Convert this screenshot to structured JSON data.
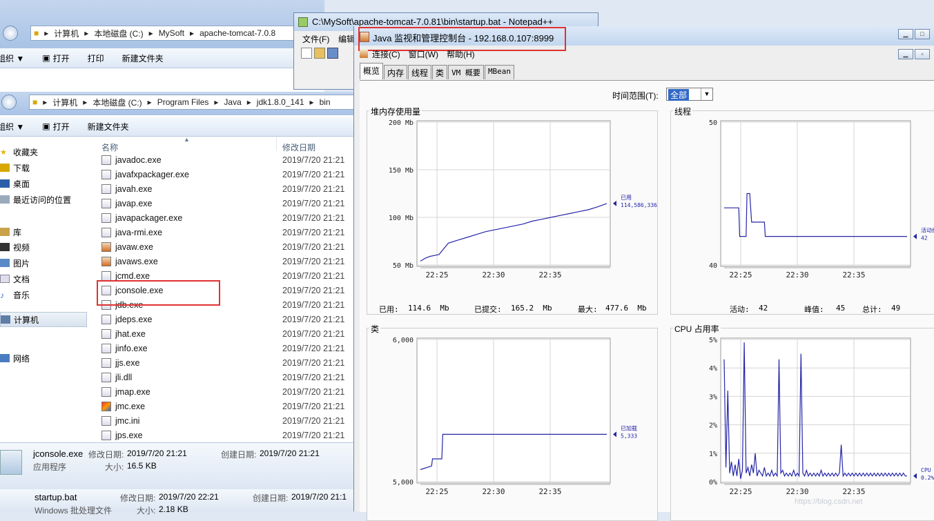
{
  "explorer1": {
    "breadcrumb": [
      "计算机",
      "本地磁盘 (C:)",
      "MySoft",
      "apache-tomcat-7.0.8"
    ],
    "toolbar": [
      "组织 ▼",
      "打开",
      "打印",
      "新建文件夹"
    ],
    "footer": {
      "name": "startup.bat",
      "modified_label": "修改日期:",
      "modified": "2019/7/20 22:21",
      "created_label": "创建日期:",
      "created": "2019/7/20 21:1",
      "type": "Windows 批处理文件",
      "size_label": "大小:",
      "size": "2.18 KB"
    }
  },
  "explorer2": {
    "breadcrumb": [
      "计算机",
      "本地磁盘 (C:)",
      "Program Files",
      "Java",
      "jdk1.8.0_141",
      "bin"
    ],
    "toolbar": [
      "组织 ▼",
      "打开",
      "新建文件夹"
    ],
    "nav": [
      "收藏夹",
      "下载",
      "桌面",
      "最近访问的位置",
      "库",
      "视频",
      "图片",
      "文档",
      "音乐",
      "计算机",
      "网络"
    ],
    "columns": {
      "name": "名称",
      "date": "修改日期"
    },
    "files": [
      {
        "name": "javadoc.exe",
        "date": "2019/7/20 21:21"
      },
      {
        "name": "javafxpackager.exe",
        "date": "2019/7/20 21:21"
      },
      {
        "name": "javah.exe",
        "date": "2019/7/20 21:21"
      },
      {
        "name": "javap.exe",
        "date": "2019/7/20 21:21"
      },
      {
        "name": "javapackager.exe",
        "date": "2019/7/20 21:21"
      },
      {
        "name": "java-rmi.exe",
        "date": "2019/7/20 21:21"
      },
      {
        "name": "javaw.exe",
        "date": "2019/7/20 21:21"
      },
      {
        "name": "javaws.exe",
        "date": "2019/7/20 21:21"
      },
      {
        "name": "jcmd.exe",
        "date": "2019/7/20 21:21"
      },
      {
        "name": "jconsole.exe",
        "date": "2019/7/20 21:21"
      },
      {
        "name": "jdb.exe",
        "date": "2019/7/20 21:21"
      },
      {
        "name": "jdeps.exe",
        "date": "2019/7/20 21:21"
      },
      {
        "name": "jhat.exe",
        "date": "2019/7/20 21:21"
      },
      {
        "name": "jinfo.exe",
        "date": "2019/7/20 21:21"
      },
      {
        "name": "jjs.exe",
        "date": "2019/7/20 21:21"
      },
      {
        "name": "jli.dll",
        "date": "2019/7/20 21:21"
      },
      {
        "name": "jmap.exe",
        "date": "2019/7/20 21:21"
      },
      {
        "name": "jmc.exe",
        "date": "2019/7/20 21:21"
      },
      {
        "name": "jmc.ini",
        "date": "2019/7/20 21:21"
      },
      {
        "name": "jps.exe",
        "date": "2019/7/20 21:21"
      }
    ],
    "details": {
      "name": "jconsole.exe",
      "modified_label": "修改日期:",
      "modified": "2019/7/20 21:21",
      "created_label": "创建日期:",
      "created": "2019/7/20 21:21",
      "type": "应用程序",
      "size_label": "大小:",
      "size": "16.5 KB"
    }
  },
  "notepad": {
    "title": "C:\\MySoft\\apache-tomcat-7.0.81\\bin\\startup.bat - Notepad++",
    "menu": [
      "文件(F)",
      "编辑"
    ]
  },
  "jconsole": {
    "title": "Java 监视和管理控制台 - 192.168.0.107:8999",
    "menu": [
      "连接(C)",
      "窗口(W)",
      "帮助(H)"
    ],
    "tabs": [
      "概览",
      "内存",
      "线程",
      "类",
      "VM 概要",
      "MBean"
    ],
    "time_range_label": "时间范围(T):",
    "time_range_value": "全部",
    "heap": {
      "title": "堆内存使用量",
      "used_label": "已用:",
      "used": "114.6  Mb",
      "committed_label": "已提交:",
      "committed": "165.2  Mb",
      "max_label": "最大:",
      "max": "477.6  Mb"
    },
    "threads": {
      "title": "线程",
      "live_label": "活动:",
      "live": "42",
      "peak_label": "峰值:",
      "peak": "45",
      "total_label": "总计:",
      "total": "49"
    },
    "classes": {
      "title": "类"
    },
    "cpu": {
      "title": "CPU 占用率"
    }
  },
  "watermark": "https://blog.csdn.net",
  "chart_data": [
    {
      "type": "line",
      "title": "堆内存使用量",
      "ylim": [
        50,
        200
      ],
      "yticks": [
        "200 Mb",
        "150 Mb",
        "100 Mb",
        "50 Mb"
      ],
      "xticks": [
        "22:25",
        "22:30",
        "22:35"
      ],
      "series": [
        {
          "name": "已用",
          "end_label": "114,586,336",
          "x": [
            0,
            0.5,
            1,
            2,
            3,
            4,
            5,
            6,
            7,
            8,
            9,
            10,
            11,
            12,
            13,
            14,
            15,
            16,
            17,
            18,
            19,
            20
          ],
          "y": [
            54,
            57,
            59,
            61,
            73,
            76,
            79,
            82,
            85,
            87,
            89,
            91,
            93,
            96,
            98,
            100,
            102,
            104,
            106,
            108,
            111,
            114.6
          ]
        }
      ]
    },
    {
      "type": "line",
      "title": "线程",
      "ylim": [
        40,
        50
      ],
      "yticks": [
        "50",
        "40"
      ],
      "xticks": [
        "22:25",
        "22:30",
        "22:35"
      ],
      "series": [
        {
          "name": "活动线程",
          "end_label": "42",
          "x": [
            0,
            1.6,
            1.7,
            2.4,
            2.5,
            2.8,
            2.9,
            3.0,
            3.1,
            4.4,
            4.5,
            20
          ],
          "y": [
            44,
            44,
            42,
            42,
            45,
            45,
            44,
            43,
            43,
            43,
            42,
            42
          ]
        }
      ]
    },
    {
      "type": "line",
      "title": "类",
      "ylim": [
        5000,
        6000
      ],
      "yticks": [
        "6,000",
        "5,000"
      ],
      "xticks": [
        "22:25",
        "22:30",
        "22:35"
      ],
      "series": [
        {
          "name": "已加载",
          "end_label": "5,333",
          "x": [
            0,
            1.2,
            1.3,
            2.3,
            2.4,
            20
          ],
          "y": [
            5085,
            5110,
            5160,
            5160,
            5333,
            5333
          ]
        }
      ]
    },
    {
      "type": "line",
      "title": "CPU 占用率",
      "ylim": [
        0,
        5
      ],
      "yticks": [
        "5%",
        "4%",
        "3%",
        "2%",
        "1%",
        "0%"
      ],
      "xticks": [
        "22:25",
        "22:30",
        "22:35"
      ],
      "series": [
        {
          "name": "CPU",
          "end_label": "0.2%",
          "x": [
            0,
            0.2,
            0.4,
            0.6,
            0.8,
            1.0,
            1.2,
            1.4,
            1.6,
            1.8,
            2.0,
            2.2,
            2.4,
            2.6,
            2.8,
            3.0,
            3.2,
            3.4,
            3.6,
            3.8,
            4.0,
            4.2,
            4.4,
            4.6,
            4.8,
            5.0,
            5.2,
            5.4,
            5.6,
            5.8,
            6.0,
            6.2,
            6.4,
            6.6,
            6.8,
            7.0,
            7.2,
            7.4,
            7.6,
            7.8,
            8.0,
            8.2,
            8.4,
            8.6,
            8.8,
            9.0,
            9.2,
            9.4,
            9.6,
            9.8,
            10.0,
            10.2,
            10.4,
            10.6,
            10.8,
            11.0,
            11.2,
            11.4,
            11.6,
            11.8,
            12.0,
            12.2,
            12.4,
            12.6,
            12.8,
            13.0,
            13.2,
            13.4,
            13.6,
            13.8,
            14.0,
            14.2,
            14.4,
            14.6,
            14.8,
            15.0,
            15.2,
            15.4,
            15.6,
            15.8,
            16.0,
            16.2,
            16.4,
            16.6,
            16.8,
            17.0,
            17.2,
            17.4,
            17.6,
            17.8,
            18.0,
            18.2,
            18.4,
            18.6,
            18.8,
            19.0,
            19.2,
            19.4,
            19.6,
            19.8,
            20.0
          ],
          "y": [
            4.3,
            0.5,
            3.2,
            0.3,
            0.7,
            0.2,
            0.6,
            0.2,
            0.8,
            0.1,
            0.4,
            4.9,
            0.3,
            0.5,
            0.2,
            0.6,
            0.3,
            1.0,
            0.2,
            0.4,
            0.3,
            0.2,
            0.5,
            0.2,
            0.3,
            0.2,
            0.4,
            0.2,
            0.3,
            0.2,
            4.3,
            0.3,
            0.4,
            0.2,
            0.3,
            0.2,
            0.3,
            0.2,
            0.4,
            0.2,
            0.3,
            0.2,
            4.5,
            0.3,
            0.2,
            0.4,
            0.2,
            0.3,
            0.2,
            0.3,
            0.2,
            0.3,
            0.2,
            0.4,
            0.2,
            0.3,
            0.2,
            0.3,
            0.2,
            0.3,
            0.2,
            0.3,
            0.2,
            0.3,
            1.3,
            0.2,
            0.3,
            0.2,
            0.3,
            0.2,
            0.3,
            0.2,
            0.3,
            0.2,
            0.3,
            0.2,
            0.3,
            0.2,
            0.3,
            0.2,
            0.3,
            0.2,
            0.3,
            0.2,
            0.3,
            0.2,
            0.3,
            0.2,
            0.3,
            0.2,
            0.3,
            0.2,
            0.3,
            0.2,
            0.3,
            0.2,
            0.3,
            0.2,
            0.3,
            0.2,
            0.2
          ]
        }
      ]
    }
  ]
}
